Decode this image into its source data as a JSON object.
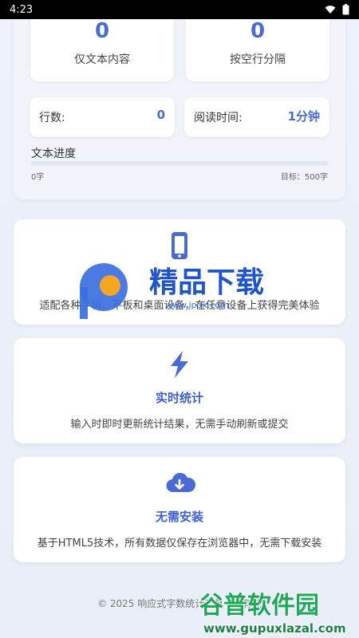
{
  "status_bar": {
    "time": "4:23"
  },
  "stats": {
    "text_only": {
      "value": "0",
      "label": "仅文本内容"
    },
    "paragraphs": {
      "value": "0",
      "label": "按空行分隔"
    },
    "lines": {
      "label": "行数:",
      "value": "0"
    },
    "reading_time": {
      "label": "阅读时间:",
      "value": "1分钟"
    },
    "progress": {
      "title": "文本进度",
      "start_label": "0字",
      "goal_label": "目标：500字",
      "fraction": 0
    }
  },
  "features": [
    {
      "icon": "mobile-phone-icon",
      "title": "",
      "description": "适配各种手机、平板和桌面设备，在任意设备上获得完美体验"
    },
    {
      "icon": "lightning-icon",
      "title": "实时统计",
      "description": "输入时即时更新统计结果，无需手动刷新或提交"
    },
    {
      "icon": "cloud-download-icon",
      "title": "无需安装",
      "description": "基于HTML5技术，所有数据仅保存在浏览器中，无需下载安装"
    }
  ],
  "footer": {
    "text": "© 2025 响应式字数统计工具 | 所有数"
  },
  "watermarks": {
    "center": {
      "text": "精品下载",
      "url": "www.jpdx.com"
    },
    "corner": {
      "text": "谷普软件园",
      "url": "www.gupuxlazal.com"
    }
  },
  "colors": {
    "accent": "#4a6bd6",
    "title_blue": "#3f5fcf",
    "background": "#eef2fa"
  }
}
